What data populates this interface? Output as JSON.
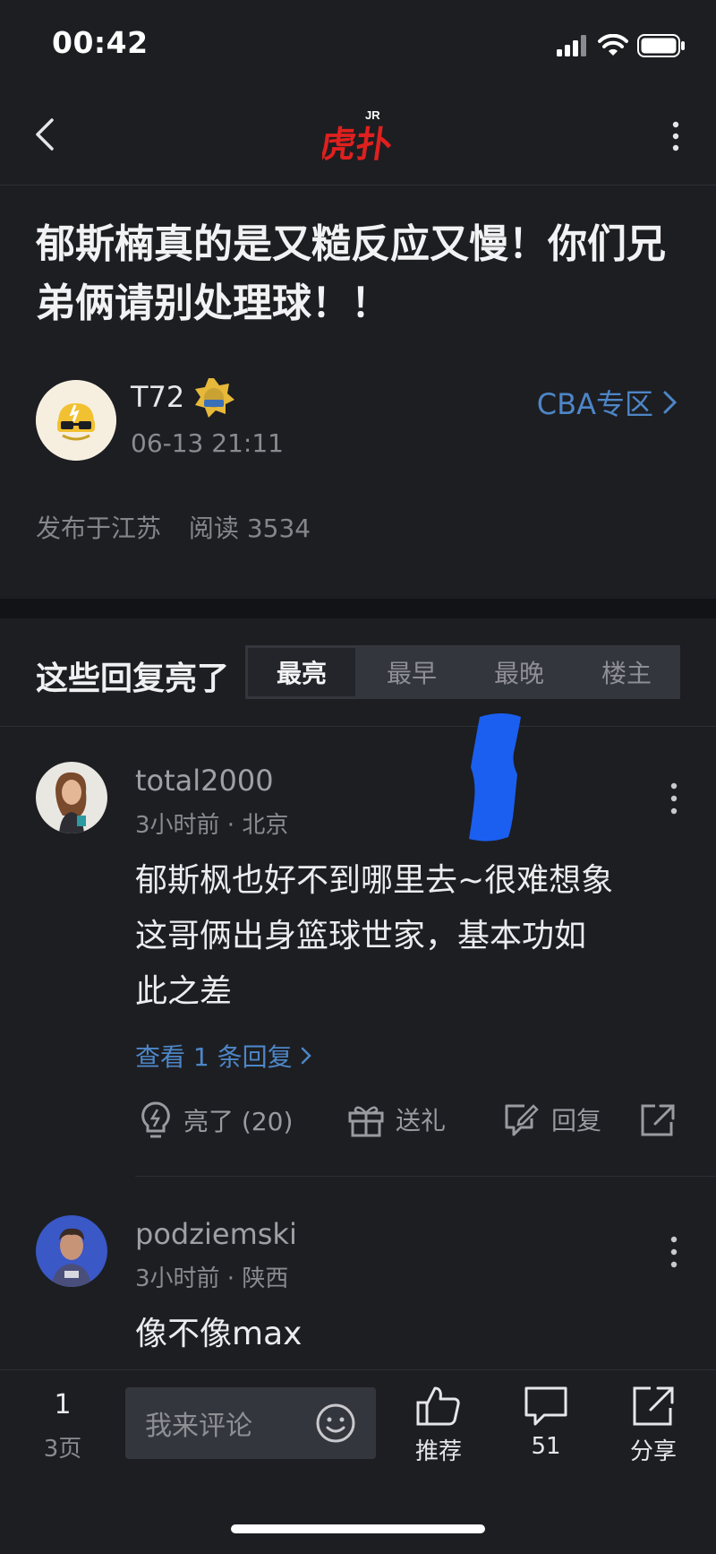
{
  "status_bar": {
    "time": "00:42"
  },
  "header": {
    "logo_text": "虎扑",
    "logo_badge": "JR"
  },
  "post": {
    "title": "郁斯楠真的是又糙反应又慢！你们兄弟俩请别处理球！！",
    "author": {
      "name": "T72",
      "time": "06-13 21:11"
    },
    "zone_label": "CBA专区",
    "location": "发布于江苏",
    "reads": "阅读 3534"
  },
  "replies": {
    "heading": "这些回复亮了",
    "sort_tabs": [
      "最亮",
      "最早",
      "最晚",
      "楼主"
    ],
    "active_tab": "最亮"
  },
  "comments": [
    {
      "user": "total2000",
      "meta": "3小时前 · 北京",
      "body": [
        "郁斯枫也好不到哪里去~很难想象",
        "这哥俩出身篮球世家，基本功如",
        "此之差"
      ],
      "view_replies": "查看 1 条回复",
      "actions": {
        "like": "亮了 (20)",
        "gift": "送礼",
        "reply": "回复"
      }
    },
    {
      "user": "podziemski",
      "meta": "3小时前 · 陕西",
      "body": [
        "像不像max"
      ]
    }
  ],
  "bottom_bar": {
    "page_current": "1",
    "page_total": "3页",
    "comment_placeholder": "我来评论",
    "recommend_label": "推荐",
    "comment_count": "51",
    "share_label": "分享"
  },
  "colors": {
    "accent_link": "#4d86c7",
    "logo_red": "#e0201e",
    "background": "#1d1e22"
  }
}
